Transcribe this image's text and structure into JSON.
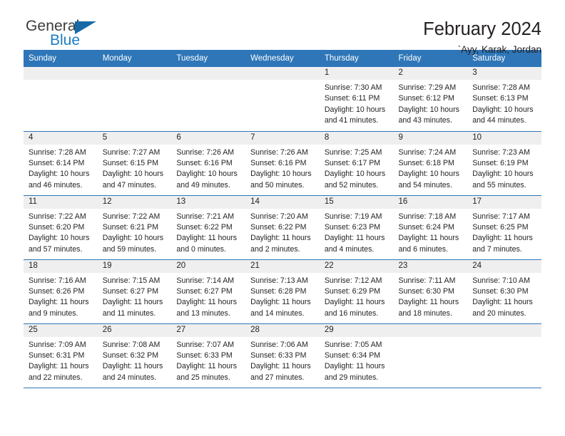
{
  "logo": {
    "primary_text": "General",
    "secondary_text": "Blue",
    "primary_color": "#3b3b3b",
    "secondary_color": "#1b7cc2",
    "triangle_color": "#1769a8"
  },
  "header": {
    "title": "February 2024",
    "subtitle": "`Ayy, Karak, Jordan"
  },
  "theme": {
    "header_blue": "#2e76b8",
    "daynum_gray": "#efefef",
    "text_color": "#231f20"
  },
  "weekdays": [
    "Sunday",
    "Monday",
    "Tuesday",
    "Wednesday",
    "Thursday",
    "Friday",
    "Saturday"
  ],
  "weeks": [
    [
      {
        "day": "",
        "empty": true
      },
      {
        "day": "",
        "empty": true
      },
      {
        "day": "",
        "empty": true
      },
      {
        "day": "",
        "empty": true
      },
      {
        "day": "1",
        "sunrise": "Sunrise: 7:30 AM",
        "sunset": "Sunset: 6:11 PM",
        "daylight1": "Daylight: 10 hours",
        "daylight2": "and 41 minutes."
      },
      {
        "day": "2",
        "sunrise": "Sunrise: 7:29 AM",
        "sunset": "Sunset: 6:12 PM",
        "daylight1": "Daylight: 10 hours",
        "daylight2": "and 43 minutes."
      },
      {
        "day": "3",
        "sunrise": "Sunrise: 7:28 AM",
        "sunset": "Sunset: 6:13 PM",
        "daylight1": "Daylight: 10 hours",
        "daylight2": "and 44 minutes."
      }
    ],
    [
      {
        "day": "4",
        "sunrise": "Sunrise: 7:28 AM",
        "sunset": "Sunset: 6:14 PM",
        "daylight1": "Daylight: 10 hours",
        "daylight2": "and 46 minutes."
      },
      {
        "day": "5",
        "sunrise": "Sunrise: 7:27 AM",
        "sunset": "Sunset: 6:15 PM",
        "daylight1": "Daylight: 10 hours",
        "daylight2": "and 47 minutes."
      },
      {
        "day": "6",
        "sunrise": "Sunrise: 7:26 AM",
        "sunset": "Sunset: 6:16 PM",
        "daylight1": "Daylight: 10 hours",
        "daylight2": "and 49 minutes."
      },
      {
        "day": "7",
        "sunrise": "Sunrise: 7:26 AM",
        "sunset": "Sunset: 6:16 PM",
        "daylight1": "Daylight: 10 hours",
        "daylight2": "and 50 minutes."
      },
      {
        "day": "8",
        "sunrise": "Sunrise: 7:25 AM",
        "sunset": "Sunset: 6:17 PM",
        "daylight1": "Daylight: 10 hours",
        "daylight2": "and 52 minutes."
      },
      {
        "day": "9",
        "sunrise": "Sunrise: 7:24 AM",
        "sunset": "Sunset: 6:18 PM",
        "daylight1": "Daylight: 10 hours",
        "daylight2": "and 54 minutes."
      },
      {
        "day": "10",
        "sunrise": "Sunrise: 7:23 AM",
        "sunset": "Sunset: 6:19 PM",
        "daylight1": "Daylight: 10 hours",
        "daylight2": "and 55 minutes."
      }
    ],
    [
      {
        "day": "11",
        "sunrise": "Sunrise: 7:22 AM",
        "sunset": "Sunset: 6:20 PM",
        "daylight1": "Daylight: 10 hours",
        "daylight2": "and 57 minutes."
      },
      {
        "day": "12",
        "sunrise": "Sunrise: 7:22 AM",
        "sunset": "Sunset: 6:21 PM",
        "daylight1": "Daylight: 10 hours",
        "daylight2": "and 59 minutes."
      },
      {
        "day": "13",
        "sunrise": "Sunrise: 7:21 AM",
        "sunset": "Sunset: 6:22 PM",
        "daylight1": "Daylight: 11 hours",
        "daylight2": "and 0 minutes."
      },
      {
        "day": "14",
        "sunrise": "Sunrise: 7:20 AM",
        "sunset": "Sunset: 6:22 PM",
        "daylight1": "Daylight: 11 hours",
        "daylight2": "and 2 minutes."
      },
      {
        "day": "15",
        "sunrise": "Sunrise: 7:19 AM",
        "sunset": "Sunset: 6:23 PM",
        "daylight1": "Daylight: 11 hours",
        "daylight2": "and 4 minutes."
      },
      {
        "day": "16",
        "sunrise": "Sunrise: 7:18 AM",
        "sunset": "Sunset: 6:24 PM",
        "daylight1": "Daylight: 11 hours",
        "daylight2": "and 6 minutes."
      },
      {
        "day": "17",
        "sunrise": "Sunrise: 7:17 AM",
        "sunset": "Sunset: 6:25 PM",
        "daylight1": "Daylight: 11 hours",
        "daylight2": "and 7 minutes."
      }
    ],
    [
      {
        "day": "18",
        "sunrise": "Sunrise: 7:16 AM",
        "sunset": "Sunset: 6:26 PM",
        "daylight1": "Daylight: 11 hours",
        "daylight2": "and 9 minutes."
      },
      {
        "day": "19",
        "sunrise": "Sunrise: 7:15 AM",
        "sunset": "Sunset: 6:27 PM",
        "daylight1": "Daylight: 11 hours",
        "daylight2": "and 11 minutes."
      },
      {
        "day": "20",
        "sunrise": "Sunrise: 7:14 AM",
        "sunset": "Sunset: 6:27 PM",
        "daylight1": "Daylight: 11 hours",
        "daylight2": "and 13 minutes."
      },
      {
        "day": "21",
        "sunrise": "Sunrise: 7:13 AM",
        "sunset": "Sunset: 6:28 PM",
        "daylight1": "Daylight: 11 hours",
        "daylight2": "and 14 minutes."
      },
      {
        "day": "22",
        "sunrise": "Sunrise: 7:12 AM",
        "sunset": "Sunset: 6:29 PM",
        "daylight1": "Daylight: 11 hours",
        "daylight2": "and 16 minutes."
      },
      {
        "day": "23",
        "sunrise": "Sunrise: 7:11 AM",
        "sunset": "Sunset: 6:30 PM",
        "daylight1": "Daylight: 11 hours",
        "daylight2": "and 18 minutes."
      },
      {
        "day": "24",
        "sunrise": "Sunrise: 7:10 AM",
        "sunset": "Sunset: 6:30 PM",
        "daylight1": "Daylight: 11 hours",
        "daylight2": "and 20 minutes."
      }
    ],
    [
      {
        "day": "25",
        "sunrise": "Sunrise: 7:09 AM",
        "sunset": "Sunset: 6:31 PM",
        "daylight1": "Daylight: 11 hours",
        "daylight2": "and 22 minutes."
      },
      {
        "day": "26",
        "sunrise": "Sunrise: 7:08 AM",
        "sunset": "Sunset: 6:32 PM",
        "daylight1": "Daylight: 11 hours",
        "daylight2": "and 24 minutes."
      },
      {
        "day": "27",
        "sunrise": "Sunrise: 7:07 AM",
        "sunset": "Sunset: 6:33 PM",
        "daylight1": "Daylight: 11 hours",
        "daylight2": "and 25 minutes."
      },
      {
        "day": "28",
        "sunrise": "Sunrise: 7:06 AM",
        "sunset": "Sunset: 6:33 PM",
        "daylight1": "Daylight: 11 hours",
        "daylight2": "and 27 minutes."
      },
      {
        "day": "29",
        "sunrise": "Sunrise: 7:05 AM",
        "sunset": "Sunset: 6:34 PM",
        "daylight1": "Daylight: 11 hours",
        "daylight2": "and 29 minutes."
      },
      {
        "day": "",
        "empty": true
      },
      {
        "day": "",
        "empty": true
      }
    ]
  ]
}
